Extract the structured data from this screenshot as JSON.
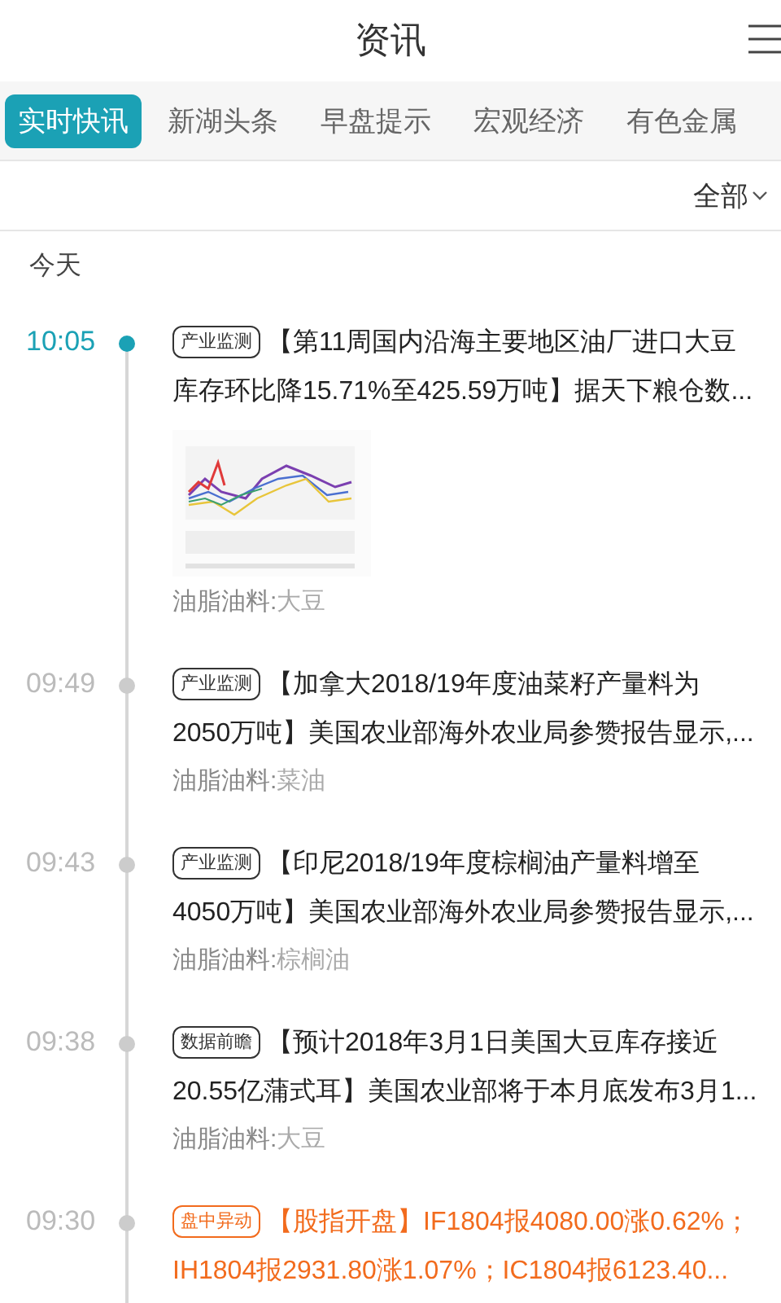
{
  "header": {
    "title": "资讯"
  },
  "tabs": [
    {
      "label": "实时快讯",
      "selected": true
    },
    {
      "label": "新湖头条",
      "selected": false
    },
    {
      "label": "早盘提示",
      "selected": false
    },
    {
      "label": "宏观经济",
      "selected": false
    },
    {
      "label": "有色金属",
      "selected": false
    }
  ],
  "filter": {
    "label": "全部"
  },
  "day_label": "今天",
  "items": [
    {
      "time": "10:05",
      "kind": "latest",
      "tag": "产业监测",
      "lines": [
        "【第11周国内沿海主要地区油厂进口大豆",
        "库存环比降15.71%至425.59万吨】据天下粮仓数..."
      ],
      "category": "油脂油料:",
      "subcategory": "大豆"
    },
    {
      "time": "09:49",
      "kind": "normal",
      "tag": "产业监测",
      "lines": [
        "【加拿大2018/19年度油菜籽产量料为",
        "2050万吨】美国农业部海外农业局参赞报告显示,..."
      ],
      "category": "油脂油料:",
      "subcategory": "菜油"
    },
    {
      "time": "09:43",
      "kind": "normal",
      "tag": "产业监测",
      "lines": [
        "【印尼2018/19年度棕榈油产量料增至",
        "4050万吨】美国农业部海外农业局参赞报告显示,..."
      ],
      "category": "油脂油料:",
      "subcategory": "棕榈油"
    },
    {
      "time": "09:38",
      "kind": "normal",
      "tag": "数据前瞻",
      "lines": [
        "【预计2018年3月1日美国大豆库存接近",
        "20.55亿蒲式耳】美国农业部将于本月底发布3月1..."
      ],
      "category": "油脂油料:",
      "subcategory": "大豆"
    },
    {
      "time": "09:30",
      "kind": "alert",
      "tag": "盘中异动",
      "lines": [
        "【股指开盘】IF1804报4080.00涨0.62%；",
        "IH1804报2931.80涨1.07%；IC1804报6123.40..."
      ]
    }
  ]
}
